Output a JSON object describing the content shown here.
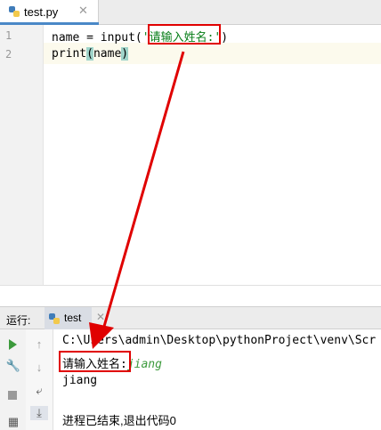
{
  "editor": {
    "tab": {
      "filename": "test.py",
      "close_glyph": "✕"
    },
    "line_numbers": [
      "1",
      "2"
    ],
    "lines": {
      "l1_pre": "name = input",
      "l1_open": "(",
      "l1_string_open": "'",
      "l1_string": "请输入姓名:",
      "l1_string_close": "'",
      "l1_close": ")",
      "l2_pre": "print",
      "l2_open": "(",
      "l2_arg": "name",
      "l2_close": ")"
    }
  },
  "run_panel": {
    "label": "运行:",
    "tab": {
      "name": "test",
      "close_glyph": "✕"
    },
    "console": {
      "command": "C:\\Users\\admin\\Desktop\\pythonProject\\venv\\Scr",
      "prompt": "请输入姓名:",
      "user_input": "jiang",
      "output": "jiang",
      "exit_message": "进程已结束,退出代码0"
    }
  },
  "colors": {
    "highlight_box": "#e00000",
    "arrow": "#e00000",
    "string": "#067d17",
    "run_icon": "#3c9a3c"
  },
  "icons": {
    "file_icon": "python-file-icon",
    "run": "run-icon",
    "wrench": "wrench-icon",
    "stop": "stop-icon",
    "up": "arrow-up-icon",
    "down": "arrow-down-icon",
    "wrap": "soft-wrap-icon",
    "scroll": "scroll-to-end-icon",
    "layout": "layout-icon"
  }
}
